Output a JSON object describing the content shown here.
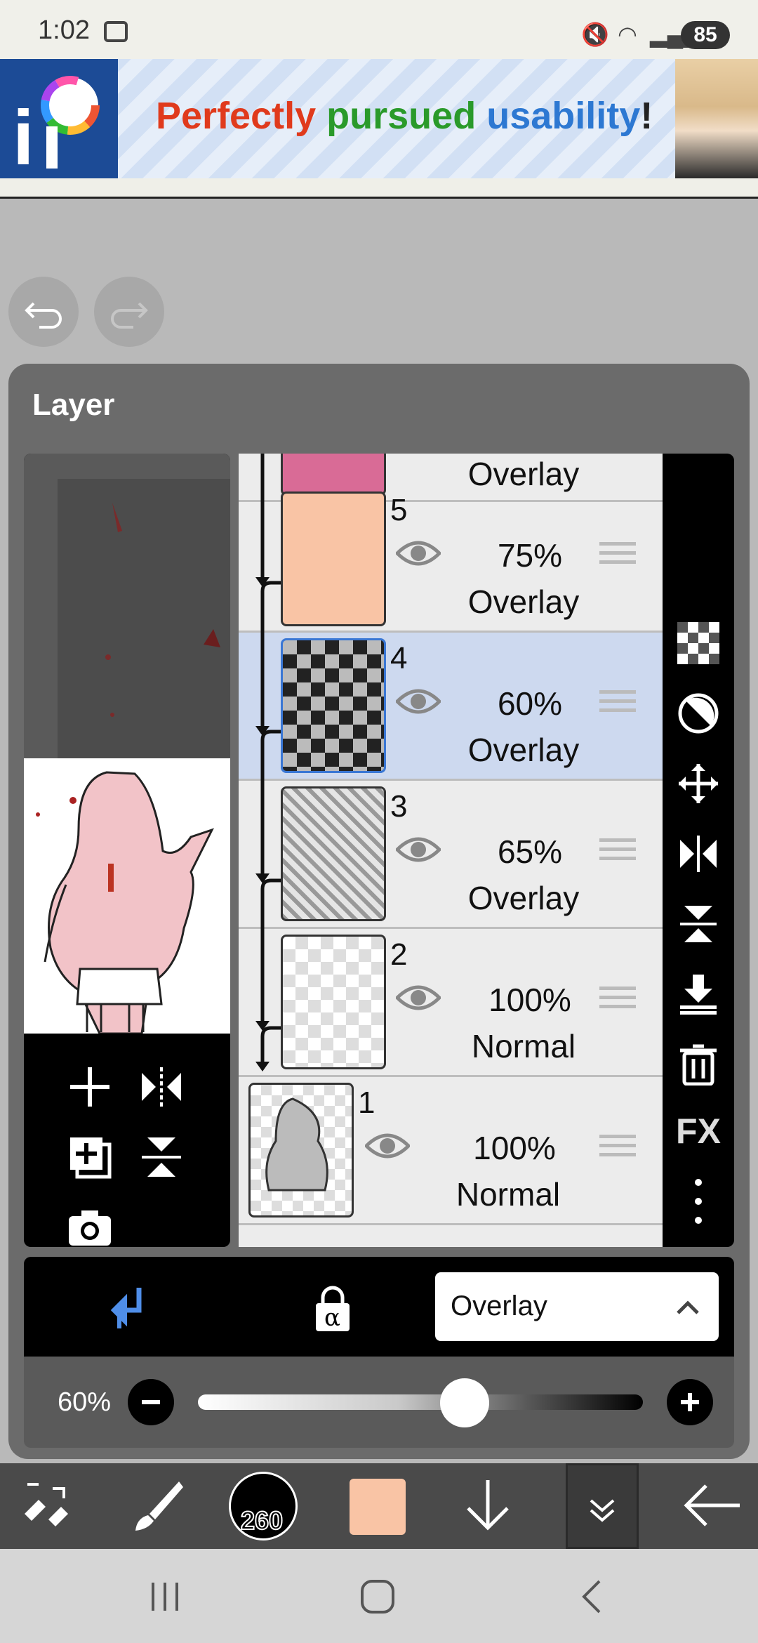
{
  "status": {
    "time": "1:02",
    "battery": "85"
  },
  "ad": {
    "word1": "Perfectly",
    "word2": "pursued",
    "word3": "usability",
    "word4": "!",
    "colors": {
      "word1": "#e03a1c",
      "word2": "#2a9a2a",
      "word3": "#2d78d2"
    }
  },
  "panel": {
    "title": "Layer"
  },
  "layers": [
    {
      "number": "5",
      "opacity": "75%",
      "mode": "Overlay"
    },
    {
      "number": "4",
      "opacity": "60%",
      "mode": "Overlay"
    },
    {
      "number": "3",
      "opacity": "65%",
      "mode": "Overlay"
    },
    {
      "number": "2",
      "opacity": "100%",
      "mode": "Normal"
    },
    {
      "number": "1",
      "opacity": "100%",
      "mode": "Normal"
    }
  ],
  "partial_top_mode": "Overlay",
  "blend": {
    "selected": "Overlay"
  },
  "opacity": {
    "label": "60%",
    "value": 0.6
  },
  "tools_fx": "FX",
  "brush_size": "260",
  "color_swatch": "#f9c4a5"
}
